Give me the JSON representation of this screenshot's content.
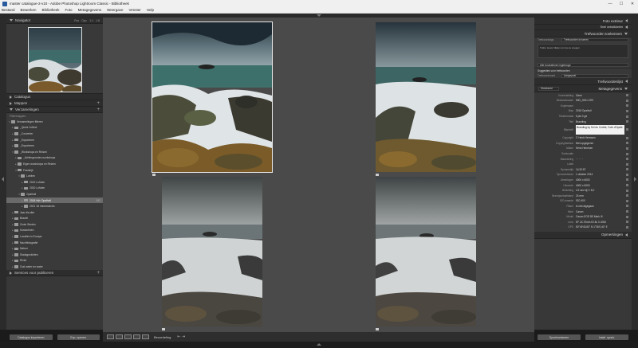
{
  "window": {
    "title": "master catalogue-2-v10 - Adobe Photoshop Lightroom Classic - Bibliotheek",
    "minimize_glyph": "—",
    "maximize_glyph": "☐",
    "close_glyph": "✕"
  },
  "menu": [
    "Bestand",
    "Bewerken",
    "Bibliotheek",
    "Foto",
    "Metagegevens",
    "Weergave",
    "Venster",
    "Help"
  ],
  "left_panel": {
    "navigator": {
      "title": "Navigator",
      "opts": [
        "Pas",
        "Opv.",
        "1:1",
        "1:8"
      ]
    },
    "catalog_label": "Catalogus",
    "folders_label": "Mappen",
    "collections_label": "Verzamelingen",
    "collections_plus": "+",
    "filter_label": "Filtermappen",
    "tree": [
      {
        "indent": 1,
        "tw": "▾",
        "name": "Verzamelingen filteren",
        "count": "",
        "selected": false
      },
      {
        "indent": 3,
        "tw": "▸",
        "name": "_Quick Collect",
        "count": "",
        "selected": false
      },
      {
        "indent": 3,
        "tw": "▸",
        "name": "_Converter",
        "count": "",
        "selected": false
      },
      {
        "indent": 3,
        "tw": "▸",
        "name": "_Exporteren",
        "count": "",
        "selected": false
      },
      {
        "indent": 3,
        "tw": "▸",
        "name": "_Exporteren",
        "count": "",
        "selected": false
      },
      {
        "indent": 3,
        "tw": "▾",
        "name": "_Workshops en Reizen",
        "count": "",
        "selected": false
      },
      {
        "indent": 5,
        "tw": "▸",
        "name": "_Achtergronden-workshops",
        "count": "",
        "selected": false
      },
      {
        "indent": 5,
        "tw": "▸",
        "name": "Eigen workshops en Reizen",
        "count": "",
        "selected": false
      },
      {
        "indent": 5,
        "tw": "▾",
        "name": "Frankrijk",
        "count": "",
        "selected": false
      },
      {
        "indent": 7,
        "tw": "▾",
        "name": "Lofoten",
        "count": "",
        "selected": false
      },
      {
        "indent": 9,
        "tw": "▸",
        "name": "2019 Lofoten",
        "count": "",
        "selected": false
      },
      {
        "indent": 9,
        "tw": "▸",
        "name": "2020 Lofoten",
        "count": "",
        "selected": false
      },
      {
        "indent": 7,
        "tw": "▾",
        "name": "Opalhull",
        "count": "",
        "selected": false
      },
      {
        "indent": 9,
        "tw": "▸",
        "name": "2018 Hi/c Opalhull",
        "count": "982",
        "selected": true
      },
      {
        "indent": 9,
        "tw": "▸",
        "name": "2021 18 Immersiereis",
        "count": "",
        "selected": false
      },
      {
        "indent": 3,
        "tw": "▸",
        "name": "Jaar dia-dier",
        "count": "",
        "selected": false
      },
      {
        "indent": 3,
        "tw": "▸",
        "name": "Braziel",
        "count": "",
        "selected": false
      },
      {
        "indent": 3,
        "tw": "▸",
        "name": "Grote Steden",
        "count": "",
        "selected": false
      },
      {
        "indent": 3,
        "tw": "▸",
        "name": "Kustsreinen",
        "count": "",
        "selected": false
      },
      {
        "indent": 3,
        "tw": "▸",
        "name": "Locaties in Europa",
        "count": "",
        "selected": false
      },
      {
        "indent": 3,
        "tw": "▸",
        "name": "Nachtfotografie",
        "count": "",
        "selected": false
      },
      {
        "indent": 3,
        "tw": "▸",
        "name": "Natuur",
        "count": "",
        "selected": false
      },
      {
        "indent": 3,
        "tw": "▸",
        "name": "Stadsgezichten",
        "count": "",
        "selected": false
      },
      {
        "indent": 3,
        "tw": "▸",
        "name": "Rivier",
        "count": "",
        "selected": false
      },
      {
        "indent": 3,
        "tw": "▸",
        "name": "Oud water en water",
        "count": "",
        "selected": false
      },
      {
        "indent": 3,
        "tw": "▸",
        "name": "Smart Collections",
        "count": "",
        "selected": false
      },
      {
        "indent": 3,
        "tw": "▸",
        "name": "Tutorials",
        "count": "",
        "selected": false
      },
      {
        "indent": 3,
        "tw": "▸",
        "name": "Uitvoegen",
        "count": "",
        "selected": false
      },
      {
        "indent": 3,
        "tw": "▸",
        "name": "Uitvoeren",
        "count": "",
        "selected": false
      },
      {
        "indent": 3,
        "tw": "▸",
        "name": "_selecties",
        "count": "",
        "selected": false
      }
    ],
    "publish_services_label": "Services voor publiceren",
    "import_button": "Catalogus importeren",
    "export_button": "Exp. openen"
  },
  "right_panel": {
    "histogram_label": "Foto extrieur",
    "quick_develop_label": "Snel ontwikkelen",
    "keywording_label": "Trefwoorden toekennen",
    "keyword_tags_label": "Trefwoordtags",
    "keyword_tags_value": "Trefwoorden invoeren",
    "keyword_tags_hint": "Trefw. Liever tikken om toe te voegen",
    "keyword_suggest": "Alle bouwstenen ingebrugd",
    "suggested_label": "Suggesties voor trefwoorden",
    "keyword_set_label": "Trefwoordenset",
    "keyword_set_value": "Aangepast",
    "keyword_list_label": "Trefwoordenlijst",
    "metadata_label": "Metagegevens",
    "preset_label": "Standaard",
    "preset_value": "Geen",
    "metadata": [
      {
        "lbl": "Voorinstelling",
        "val": "Geen"
      },
      {
        "lbl": "Bestandsnaam",
        "val": "IMG_0001.CR2"
      },
      {
        "lbl": "Kopienaam",
        "val": ""
      },
      {
        "lbl": "Map",
        "val": "2018 Opalhull"
      },
      {
        "lbl": "Tekstformaat",
        "val": "6 pts 0 gd"
      },
      {
        "lbl": "Titel",
        "val": "Branding"
      },
      {
        "lbl": "Bijschrift",
        "val": "Branding by Sol du Corbet, Cote d'Opale"
      },
      {
        "lbl": "Copyright",
        "val": "© Henk Hermsen"
      },
      {
        "lbl": "Copyrightstatus",
        "val": "Niet opgegeven"
      },
      {
        "lbl": "Maker",
        "val": "Henk Hermsen"
      },
      {
        "lbl": "Sublocatie",
        "val": ""
      },
      {
        "lbl": "Waardering",
        "val": "· · · · ·"
      },
      {
        "lbl": "Label",
        "val": ""
      },
      {
        "lbl": "Opnametijd",
        "val": "14:32:57"
      },
      {
        "lbl": "Opnamedatum",
        "val": "1 oktober 2014"
      },
      {
        "lbl": "Afmetingen",
        "val": "4000 x 6000"
      },
      {
        "lbl": "Uitsnede",
        "val": "4000 x 6000"
      },
      {
        "lbl": "Belichting",
        "val": "1/2 sec bij f / 8,0"
      },
      {
        "lbl": "Brandpuntsafstand",
        "val": "24 mm"
      },
      {
        "lbl": "ISO-waarde",
        "val": "ISO 400"
      },
      {
        "lbl": "Flitser",
        "val": "Is niet afgegaan"
      },
      {
        "lbl": "Merk",
        "val": "Canon"
      },
      {
        "lbl": "Model",
        "val": "Canon EOS 5D Mark III"
      },
      {
        "lbl": "Lens",
        "val": "EF 24-70mm f/2.8L II USM"
      },
      {
        "lbl": "GPS",
        "val": "50°49'40,83\" N 1°36'0,40\" E"
      }
    ],
    "comments_label": "Opmerkingen",
    "sync_button": "Synchroniseren",
    "sync_settings_button": "Instel. synch."
  },
  "toolbar": {
    "sort_label": "Beoordeling",
    "prev_next": "⇤ ⇥"
  },
  "colors": {
    "panel_bg": "#383838",
    "center_bg": "#4a4a4a",
    "selected_row": "#6a6a6a"
  }
}
